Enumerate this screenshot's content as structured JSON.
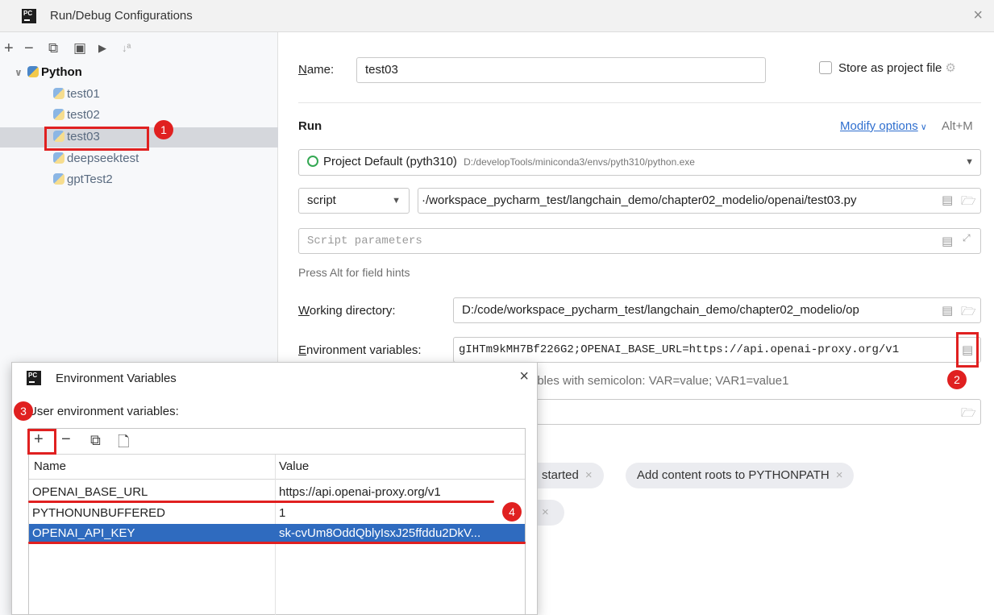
{
  "window": {
    "title": "Run/Debug Configurations",
    "logo": "PC"
  },
  "toolbar": {
    "add": "+",
    "remove": "−",
    "copy": "⧉",
    "save": "▣",
    "folder": "▶",
    "sort": "↓ª"
  },
  "tree": {
    "root": "Python",
    "items": [
      "test01",
      "test02",
      "test03",
      "deepseektest",
      "gptTest2"
    ]
  },
  "form": {
    "name_label": "Name:",
    "name_value": "test03",
    "store_label": "Store as project file",
    "run_heading": "Run",
    "modify_options": "Modify options",
    "modify_shortcut": "Alt+M",
    "interpreter_name": "Project Default (pyth310)",
    "interpreter_path": "D:/developTools/miniconda3/envs/pyth310/python.exe",
    "script_type": "script",
    "script_path": "·/workspace_pycharm_test/langchain_demo/chapter02_modelio/openai/test03.py",
    "script_params_placeholder": "Script parameters",
    "field_hints": "Press Alt for field hints",
    "workdir_label": "Working directory:",
    "workdir_value": "D:/code/workspace_pycharm_test/langchain_demo/chapter02_modelio/op\u0001",
    "env_label": "Environment variables:",
    "env_value": "gIHTm9kMH7Bf226G2;OPENAI_BASE_URL=https://api.openai-proxy.org/v1",
    "env_hint_partial": "ables with semicolon: VAR=value; VAR1=value1",
    "chip1": "started",
    "chip2": "Add content roots to PYTHONPATH"
  },
  "env_dialog": {
    "title": "Environment Variables",
    "user_label": "User environment variables:",
    "col_name": "Name",
    "col_value": "Value",
    "rows": [
      {
        "name": "OPENAI_BASE_URL",
        "value": "https://api.openai-proxy.org/v1"
      },
      {
        "name": "PYTHONUNBUFFERED",
        "value": "1"
      },
      {
        "name": "OPENAI_API_KEY",
        "value": "sk-cvUm8OddQblyIsxJ25ffddu2DkV..."
      }
    ],
    "selected_row": 2
  },
  "badges": [
    "1",
    "2",
    "3",
    "4"
  ],
  "colors": {
    "annotation": "#e02020",
    "selection": "#2f6bbf",
    "link": "#2f6fcf"
  }
}
